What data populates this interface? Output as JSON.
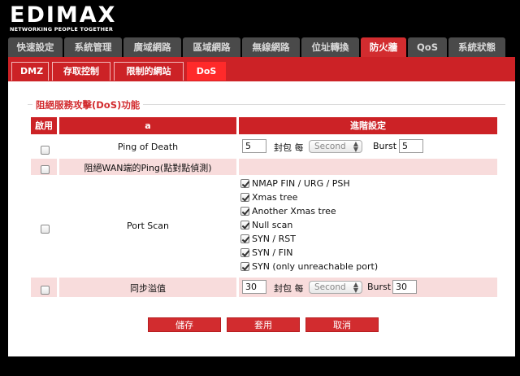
{
  "brand": {
    "logo": "EDIMAX",
    "tagline": "NETWORKING PEOPLE TOGETHER"
  },
  "main_tabs": [
    {
      "label": "快速設定"
    },
    {
      "label": "系統管理"
    },
    {
      "label": "廣域網路"
    },
    {
      "label": "區域網路"
    },
    {
      "label": "無線網路"
    },
    {
      "label": "位址轉換"
    },
    {
      "label": "防火牆",
      "active": true
    },
    {
      "label": "QoS"
    },
    {
      "label": "系統狀態"
    }
  ],
  "sub_tabs": [
    {
      "label": "DMZ"
    },
    {
      "label": "存取控制"
    },
    {
      "label": "限制的網站"
    },
    {
      "label": "DoS",
      "active": true
    }
  ],
  "section": {
    "legend": "阻絕服務攻擊(DoS)功能"
  },
  "table": {
    "headers": {
      "enable": "啟用",
      "name": "a",
      "advanced": "進階設定"
    },
    "rows": {
      "ping_of_death": {
        "name": "Ping of Death",
        "packets": "5",
        "packets_label": "封包 每",
        "unit": "Second",
        "burst_label": "Burst",
        "burst": "5"
      },
      "wan_ping": {
        "name": "阻絕WAN端的Ping(點對點偵測)"
      },
      "port_scan": {
        "name": "Port Scan",
        "options": [
          "NMAP FIN / URG / PSH",
          "Xmas tree",
          "Another Xmas tree",
          "Null scan",
          "SYN / RST",
          "SYN / FIN",
          "SYN (only unreachable port)"
        ]
      },
      "syn_flood": {
        "name": "同步溢值",
        "packets": "30",
        "packets_label": "封包 每",
        "unit": "Second",
        "burst_label": "Burst",
        "burst": "30"
      }
    }
  },
  "buttons": {
    "save": "儲存",
    "apply": "套用",
    "cancel": "取消"
  },
  "colors": {
    "accent": "#cc2226",
    "row_pink": "#f8dcdc",
    "tab_gray": "#4a4a4a"
  }
}
